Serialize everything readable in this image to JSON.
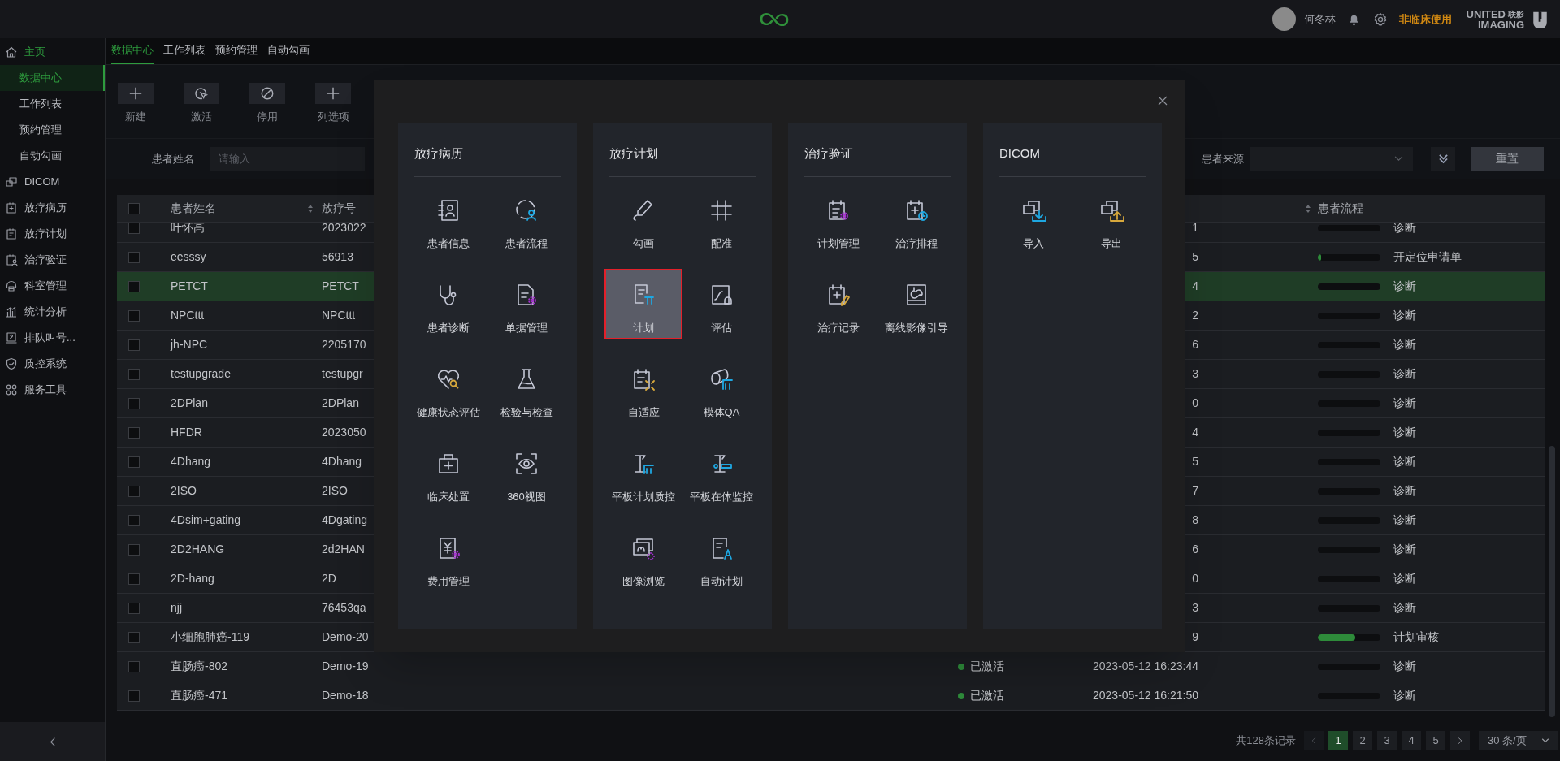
{
  "top_bar": {
    "user": "何冬林",
    "badge": "非临床使用",
    "brand": [
      "UNITED",
      "联影",
      "IMAGING"
    ]
  },
  "sidebar": {
    "items": [
      {
        "label": "主页",
        "selected": true,
        "children": [
          {
            "label": "数据中心",
            "selected": true
          },
          {
            "label": "工作列表",
            "selected": false
          },
          {
            "label": "预约管理",
            "selected": false
          },
          {
            "label": "自动勾画",
            "selected": false
          }
        ]
      },
      {
        "label": "DICOM",
        "selected": false
      },
      {
        "label": "放疗病历",
        "selected": false
      },
      {
        "label": "放疗计划",
        "selected": false
      },
      {
        "label": "治疗验证",
        "selected": false
      },
      {
        "label": "科室管理",
        "selected": false
      },
      {
        "label": "统计分析",
        "selected": false
      },
      {
        "label": "排队叫号...",
        "selected": false
      },
      {
        "label": "质控系统",
        "selected": false
      },
      {
        "label": "服务工具",
        "selected": false
      }
    ]
  },
  "tabs": [
    {
      "label": "数据中心",
      "selected": true
    },
    {
      "label": "工作列表",
      "selected": false
    },
    {
      "label": "预约管理",
      "selected": false
    },
    {
      "label": "自动勾画",
      "selected": false
    }
  ],
  "toolbar": [
    {
      "label": "新建"
    },
    {
      "label": "激活"
    },
    {
      "label": "停用"
    },
    {
      "label": "列选项"
    }
  ],
  "filters": {
    "name_label": "患者姓名",
    "name_placeholder": "请输入",
    "source_label": "患者来源",
    "reset_button": "重置"
  },
  "table": {
    "columns": [
      "患者姓名",
      "放疗号",
      "患者流程"
    ],
    "header_checkbox": {
      "checked": false
    },
    "rows": [
      {
        "name": "叶怀高",
        "number": "2023022",
        "date": "1",
        "flow": "诊断",
        "level": 0,
        "checked": false,
        "selected": false
      },
      {
        "name": "eesssy",
        "number": "56913",
        "date": "5",
        "flow": "开定位申请单",
        "level": 0.05,
        "checked": false,
        "selected": false
      },
      {
        "name": "PETCT",
        "number": "PETCT",
        "date": "4",
        "flow": "诊断",
        "level": 0,
        "checked": false,
        "selected": true
      },
      {
        "name": "NPCttt",
        "number": "NPCttt",
        "date": "2",
        "flow": "诊断",
        "level": 0,
        "checked": false,
        "selected": false
      },
      {
        "name": "jh-NPC",
        "number": "2205170",
        "date": "6",
        "flow": "诊断",
        "level": 0,
        "checked": false,
        "selected": false
      },
      {
        "name": "testupgrade",
        "number": "testupgr",
        "date": "3",
        "flow": "诊断",
        "level": 0,
        "checked": false,
        "selected": false
      },
      {
        "name": "2DPlan",
        "number": "2DPlan",
        "date": "0",
        "flow": "诊断",
        "level": 0,
        "checked": false,
        "selected": false
      },
      {
        "name": "HFDR",
        "number": "2023050",
        "date": "4",
        "flow": "诊断",
        "level": 0,
        "checked": false,
        "selected": false
      },
      {
        "name": "4Dhang",
        "number": "4Dhang",
        "date": "5",
        "flow": "诊断",
        "level": 0,
        "checked": false,
        "selected": false
      },
      {
        "name": "2ISO",
        "number": "2ISO",
        "date": "7",
        "flow": "诊断",
        "level": 0,
        "checked": false,
        "selected": false
      },
      {
        "name": "4Dsim+gating",
        "number": "4Dgating",
        "date": "8",
        "flow": "诊断",
        "level": 0,
        "checked": false,
        "selected": false
      },
      {
        "name": "2D2HANG",
        "number": "2d2HAN",
        "date": "6",
        "flow": "诊断",
        "level": 0,
        "checked": false,
        "selected": false
      },
      {
        "name": "2D-hang",
        "number": "2D",
        "date": "0",
        "flow": "诊断",
        "level": 0,
        "checked": false,
        "selected": false
      },
      {
        "name": "njj",
        "number": "76453qa",
        "date": "3",
        "flow": "诊断",
        "level": 0,
        "checked": false,
        "selected": false
      },
      {
        "name": "小细胞肺癌-119",
        "number": "Demo-20",
        "date": "9",
        "flow": "计划审核",
        "level": 0.6,
        "checked": false,
        "selected": false
      },
      {
        "name": "直肠癌-802",
        "number": "Demo-19",
        "status": "已激活",
        "date": "2023-05-12 16:23:44",
        "flow": "诊断",
        "level": 0,
        "checked": false,
        "selected": false
      },
      {
        "name": "直肠癌-471",
        "number": "Demo-18",
        "status": "已激活",
        "date": "2023-05-12 16:21:50",
        "flow": "诊断",
        "level": 0,
        "checked": false,
        "selected": false
      }
    ]
  },
  "pagination": {
    "total": "共128条记录",
    "pages": [
      {
        "label": "1",
        "selected": true
      },
      {
        "label": "2",
        "selected": false
      },
      {
        "label": "3",
        "selected": false
      },
      {
        "label": "4",
        "selected": false
      },
      {
        "label": "5",
        "selected": false
      }
    ],
    "page_size": "30 条/页"
  },
  "modal": {
    "panels": [
      {
        "title": "放疗病历",
        "items": [
          {
            "label": "患者信息",
            "selected": false
          },
          {
            "label": "患者流程",
            "selected": false
          },
          {
            "label": "患者诊断",
            "selected": false
          },
          {
            "label": "单据管理",
            "selected": false
          },
          {
            "label": "健康状态评估",
            "selected": false
          },
          {
            "label": "检验与检查",
            "selected": false
          },
          {
            "label": "临床处置",
            "selected": false
          },
          {
            "label": "360视图",
            "selected": false
          },
          {
            "label": "费用管理",
            "selected": false
          }
        ]
      },
      {
        "title": "放疗计划",
        "items": [
          {
            "label": "勾画",
            "selected": false
          },
          {
            "label": "配准",
            "selected": false
          },
          {
            "label": "计划",
            "selected": true
          },
          {
            "label": "评估",
            "selected": false
          },
          {
            "label": "自适应",
            "selected": false
          },
          {
            "label": "模体QA",
            "selected": false
          },
          {
            "label": "平板计划质控",
            "selected": false
          },
          {
            "label": "平板在体监控",
            "selected": false
          },
          {
            "label": "图像浏览",
            "selected": false
          },
          {
            "label": "自动计划",
            "selected": false
          }
        ]
      },
      {
        "title": "治疗验证",
        "items": [
          {
            "label": "计划管理",
            "selected": false
          },
          {
            "label": "治疗排程",
            "selected": false
          },
          {
            "label": "治疗记录",
            "selected": false
          },
          {
            "label": "离线影像引导",
            "selected": false
          }
        ]
      },
      {
        "title": "DICOM",
        "items": [
          {
            "label": "导入",
            "selected": false
          },
          {
            "label": "导出",
            "selected": false
          }
        ]
      }
    ]
  }
}
